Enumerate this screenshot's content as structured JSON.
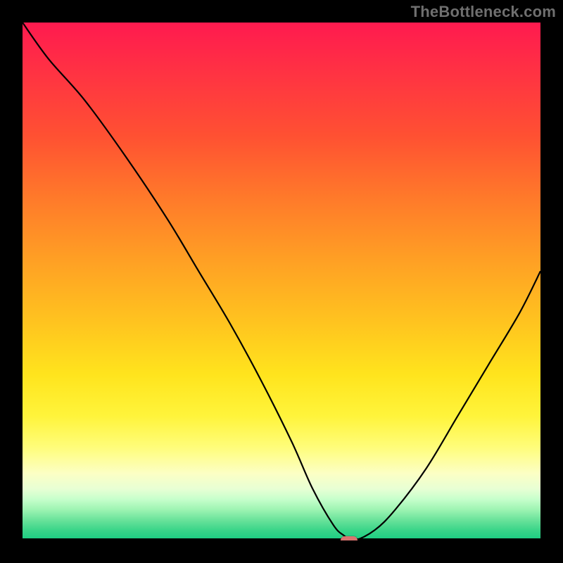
{
  "watermark": "TheBottleneck.com",
  "chart_data": {
    "type": "line",
    "title": "",
    "xlabel": "",
    "ylabel": "",
    "xlim": [
      0,
      100
    ],
    "ylim": [
      0,
      100
    ],
    "grid": false,
    "legend": false,
    "background": "vertical-rainbow-gradient",
    "series": [
      {
        "name": "bottleneck-curve",
        "x": [
          0,
          5,
          12,
          20,
          28,
          34,
          40,
          46,
          52,
          56,
          60,
          62,
          64,
          68,
          72,
          78,
          84,
          90,
          96,
          100
        ],
        "values": [
          100,
          93,
          85,
          74,
          62,
          52,
          42,
          31,
          19,
          10,
          3,
          1,
          0,
          2,
          6,
          14,
          24,
          34,
          44,
          52
        ]
      }
    ],
    "marker": {
      "x": 63,
      "y": 0,
      "shape": "pill",
      "color": "#d9736f"
    },
    "gradient_stops": [
      {
        "pct": 0,
        "color": "#ff1a4f"
      },
      {
        "pct": 22,
        "color": "#ff5132"
      },
      {
        "pct": 46,
        "color": "#ffa024"
      },
      {
        "pct": 68,
        "color": "#ffe41d"
      },
      {
        "pct": 87,
        "color": "#fcffc4"
      },
      {
        "pct": 100,
        "color": "#18cd82"
      }
    ]
  }
}
